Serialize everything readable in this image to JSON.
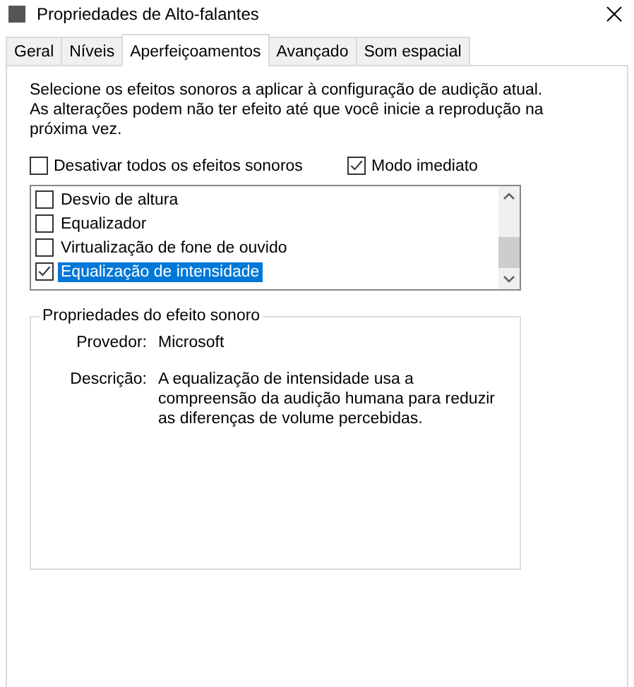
{
  "window": {
    "title": "Propriedades de Alto-falantes"
  },
  "tabs": [
    {
      "label": "Geral",
      "selected": false
    },
    {
      "label": "Níveis",
      "selected": false
    },
    {
      "label": "Aperfeiçoamentos",
      "selected": true
    },
    {
      "label": "Avançado",
      "selected": false
    },
    {
      "label": "Som espacial",
      "selected": false
    }
  ],
  "intro": "Selecione os efeitos sonoros a aplicar à configuração de audição atual. As alterações podem não ter efeito até que você inicie a reprodução na próxima vez.",
  "options": [
    {
      "label": "Desativar todos os efeitos sonoros",
      "checked": false
    },
    {
      "label": "Modo imediato",
      "checked": true
    }
  ],
  "effects": [
    {
      "label": "Desvio de altura",
      "checked": false,
      "selected": false
    },
    {
      "label": "Equalizador",
      "checked": false,
      "selected": false
    },
    {
      "label": "Virtualização de fone de ouvido",
      "checked": false,
      "selected": false
    },
    {
      "label": "Equalização de intensidade",
      "checked": true,
      "selected": true
    }
  ],
  "properties": {
    "title": "Propriedades do efeito sonoro",
    "rows": [
      {
        "label": "Provedor:",
        "value": "Microsoft"
      },
      {
        "label": "Descrição:",
        "value": "A equalização de intensidade usa a compreensão da audição humana para reduzir as diferenças de volume percebidas."
      }
    ]
  }
}
